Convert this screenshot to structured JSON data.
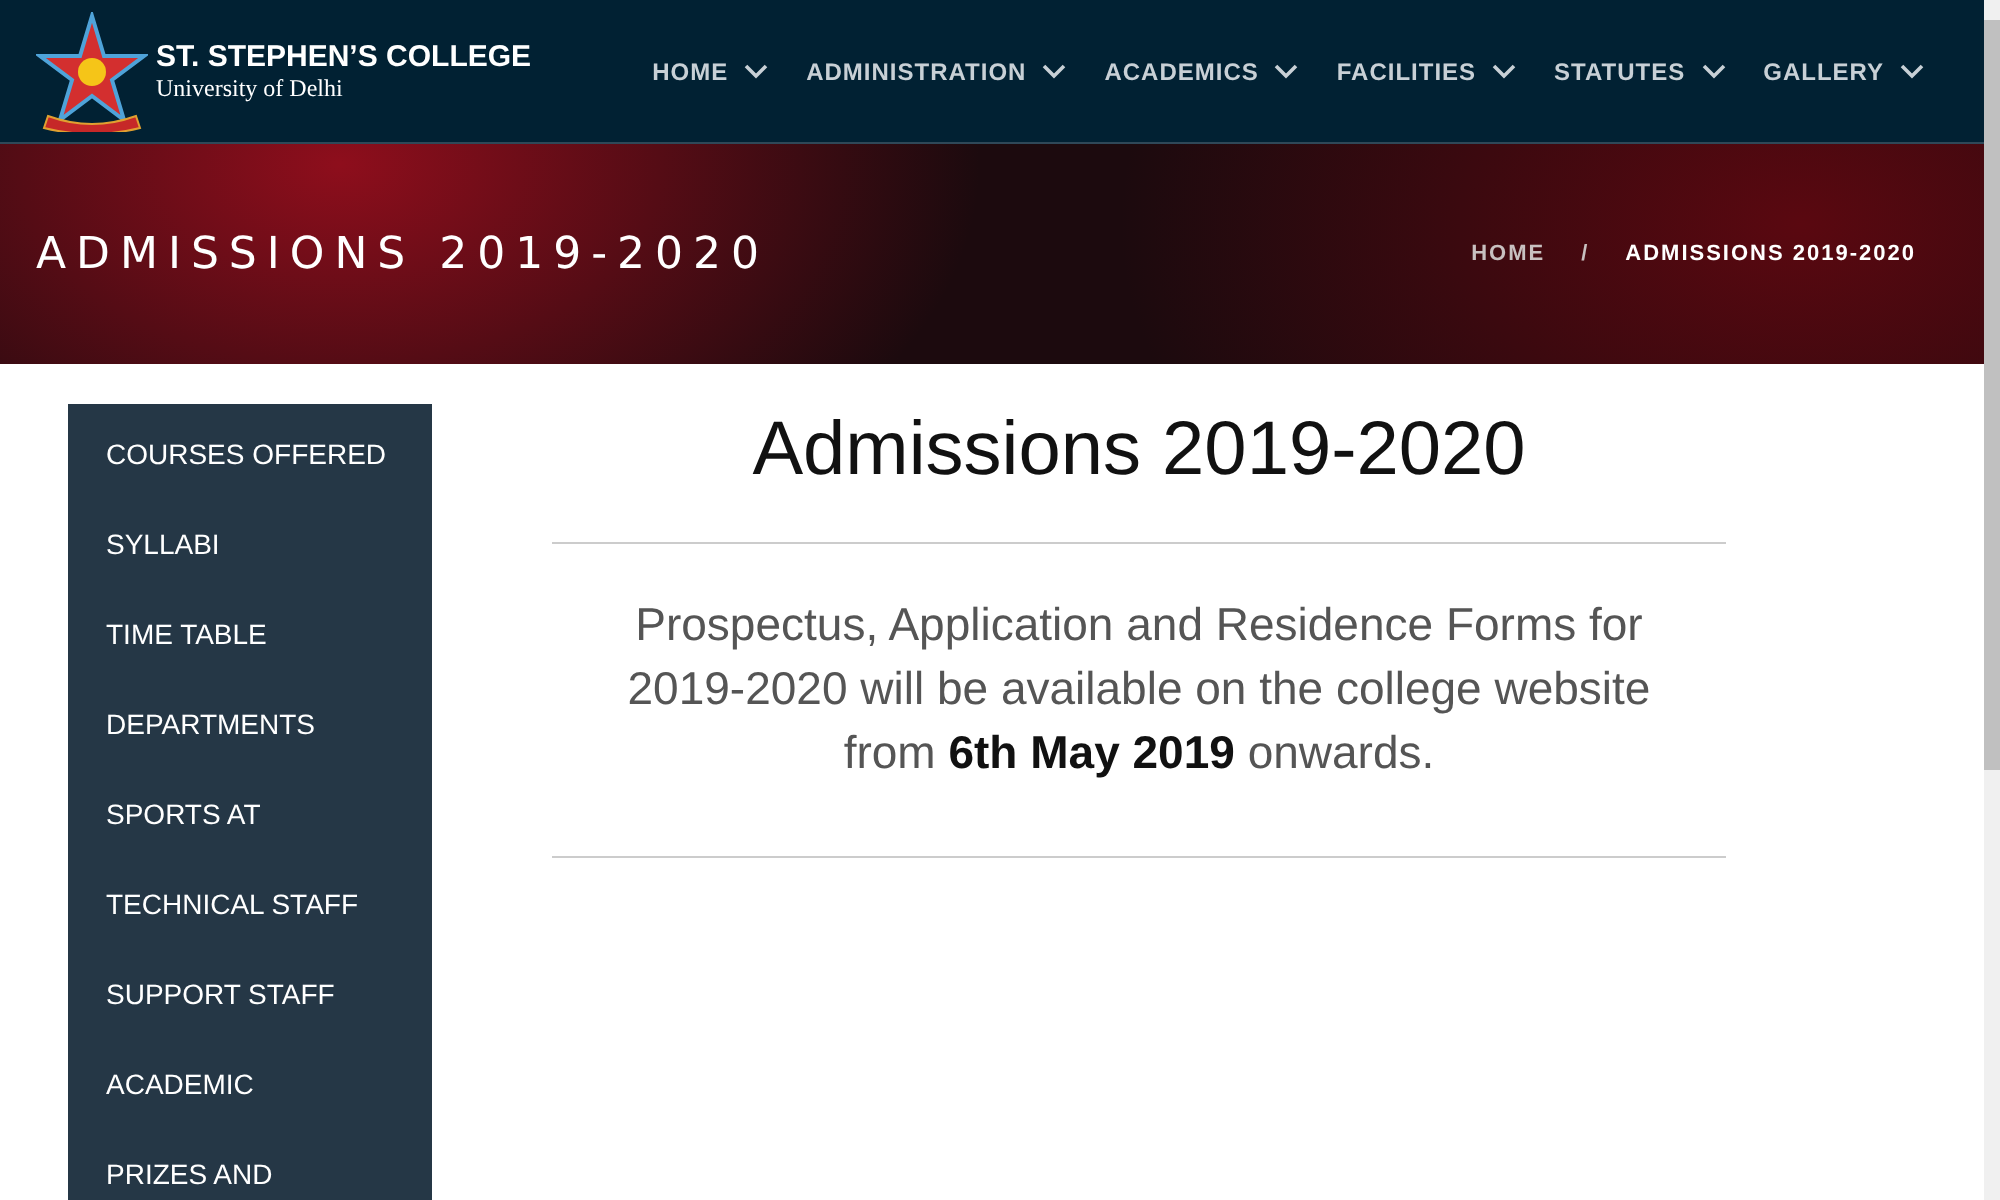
{
  "header": {
    "college_name": "ST. STEPHEN’S COLLEGE",
    "subtitle": "University of Delhi"
  },
  "nav": [
    {
      "label": "HOME",
      "has_dropdown": true
    },
    {
      "label": "ADMINISTRATION",
      "has_dropdown": true
    },
    {
      "label": "ACADEMICS",
      "has_dropdown": true
    },
    {
      "label": "FACILITIES",
      "has_dropdown": true
    },
    {
      "label": "STATUTES",
      "has_dropdown": true
    },
    {
      "label": "GALLERY",
      "has_dropdown": true
    }
  ],
  "banner": {
    "title": "ADMISSIONS 2019-2020",
    "breadcrumb": [
      "HOME",
      "/",
      "ADMISSIONS 2019-2020"
    ]
  },
  "sidebar": {
    "items": [
      "COURSES OFFERED",
      "SYLLABI",
      "TIME TABLE",
      "DEPARTMENTS",
      "SPORTS AT",
      "TECHNICAL STAFF",
      "SUPPORT STAFF",
      "ACADEMIC",
      "PRIZES AND"
    ]
  },
  "content": {
    "heading": "Admissions 2019-2020",
    "text": "Prospectus, Application and Residence Forms for 2019-2020 will be available on the college website from **6th May 2019** onwards."
  }
}
